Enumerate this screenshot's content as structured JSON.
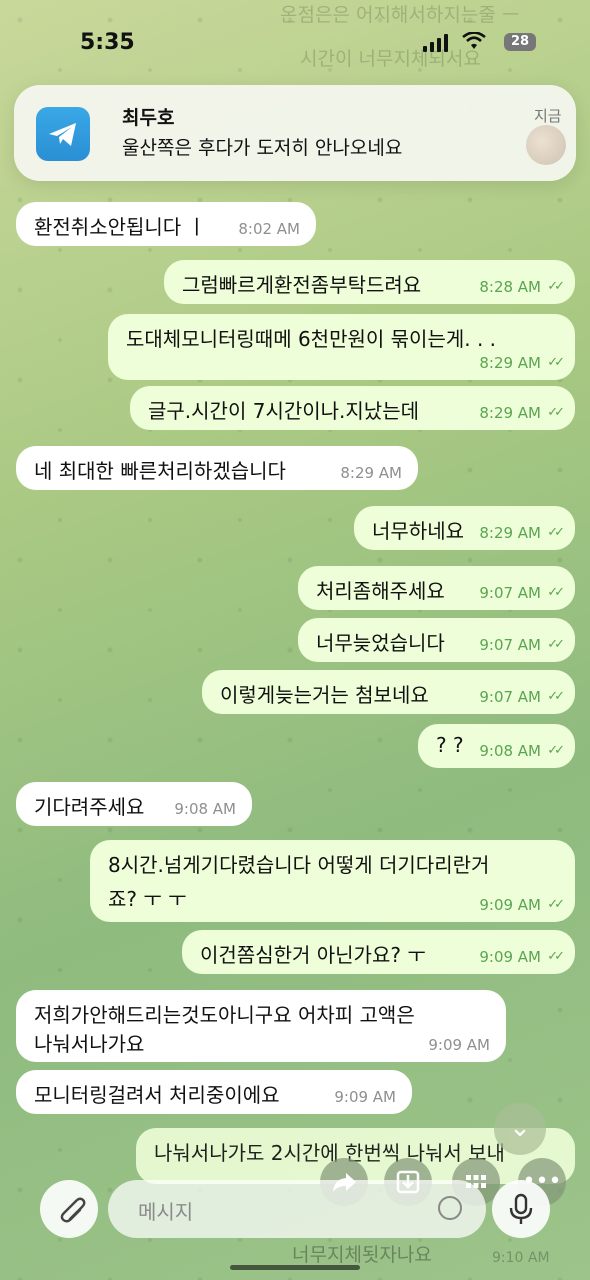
{
  "status_bar": {
    "time": "5:35",
    "battery": "28"
  },
  "notification": {
    "sender": "최두호",
    "preview": "울산쪽은 후다가 도저히 안나오네요",
    "when": "지금"
  },
  "ghost_texts": {
    "top1": "온점은은 어지해서하지는줄 ㅡ",
    "top2": "시간이 너무지체되서요",
    "bottom": "너무지체됫자나요",
    "bottom_time": "9:10 AM"
  },
  "messages": [
    {
      "dir": "in",
      "text": "환전취소안됩니다 ㅣ",
      "time": "8:02 AM"
    },
    {
      "dir": "out",
      "text": "그럼빠르게환전좀부탁드려요",
      "time": "8:28 AM"
    },
    {
      "dir": "out",
      "text": "도대체모니터링때메 6천만원이 묶이는게. . .",
      "time": "8:29 AM"
    },
    {
      "dir": "out",
      "text": "글구.시간이 7시간이나.지났는데",
      "time": "8:29 AM"
    },
    {
      "dir": "in",
      "text": "네 최대한 빠른처리하겠습니다",
      "time": "8:29 AM"
    },
    {
      "dir": "out",
      "text": "너무하네요",
      "time": "8:29 AM"
    },
    {
      "dir": "out",
      "text": "처리좀해주세요",
      "time": "9:07 AM"
    },
    {
      "dir": "out",
      "text": "너무늦었습니다",
      "time": "9:07 AM"
    },
    {
      "dir": "out",
      "text": "이렇게늦는거는 첨보네요",
      "time": "9:07 AM"
    },
    {
      "dir": "out",
      "text": "? ?",
      "time": "9:08 AM"
    },
    {
      "dir": "in",
      "text": "기다려주세요",
      "time": "9:08 AM"
    },
    {
      "dir": "out",
      "text": "8시간.넘게기다렸습니다 어떻게 더기다리란거",
      "text2": "죠? ㅜ ㅜ",
      "time": "9:09 AM"
    },
    {
      "dir": "out",
      "text": "이건쫌심한거 아닌가요? ㅜ",
      "time": "9:09 AM"
    },
    {
      "dir": "in",
      "text": "저희가안해드리는것도아니구요 어차피 고액은",
      "text2": "나눠서나가요",
      "time": "9:09 AM"
    },
    {
      "dir": "in",
      "text": "모니터링걸려서 처리중이에요",
      "time": "9:09 AM"
    },
    {
      "dir": "out",
      "text": "나눠서나가도 2시간에 한번씩 나눠서 보내",
      "time": ""
    }
  ],
  "composer": {
    "placeholder": "메시지"
  },
  "colors": {
    "incoming": "#ffffff",
    "outgoing": "#eefed8",
    "time_out": "#5aa552",
    "time_in": "#8f8f8f"
  },
  "icons": [
    "telegram-icon",
    "paperclip-icon",
    "sticker-icon",
    "microphone-icon",
    "share-icon",
    "download-icon",
    "grid-icon",
    "more-icon",
    "chevron-down-icon"
  ]
}
